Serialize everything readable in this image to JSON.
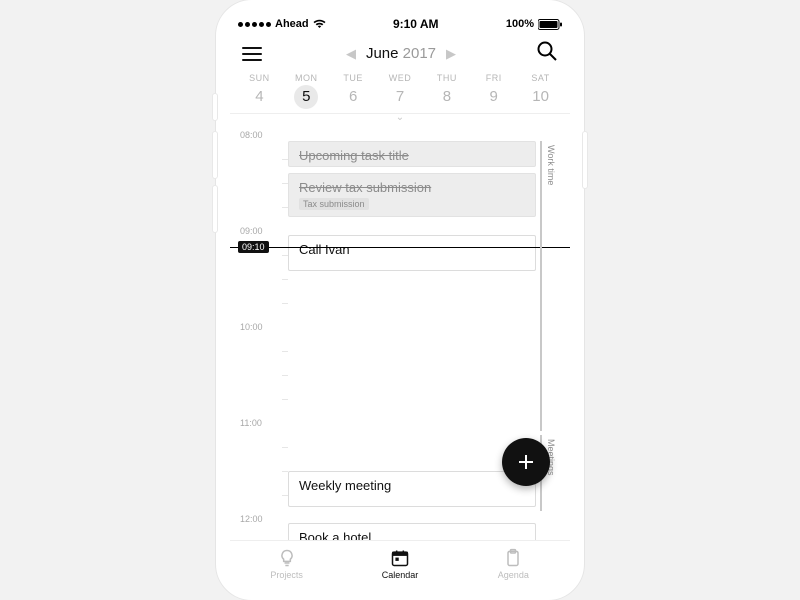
{
  "statusbar": {
    "carrier": "Ahead",
    "time": "9:10 AM",
    "battery": "100%"
  },
  "header": {
    "month": "June",
    "year": "2017"
  },
  "week": [
    {
      "dow": "SUN",
      "day": "4"
    },
    {
      "dow": "MON",
      "day": "5",
      "selected": true
    },
    {
      "dow": "TUE",
      "day": "6"
    },
    {
      "dow": "WED",
      "day": "7"
    },
    {
      "dow": "THU",
      "day": "8"
    },
    {
      "dow": "FRI",
      "day": "9"
    },
    {
      "dow": "SAT",
      "day": "10"
    }
  ],
  "hours": [
    "08:00",
    "09:00",
    "10:00",
    "11:00",
    "12:00"
  ],
  "now": "09:10",
  "events": {
    "upcoming": {
      "title": "Upcoming task title"
    },
    "review": {
      "title": "Review tax submission",
      "tag": "Tax submission"
    },
    "call": {
      "title": "Call Ivan"
    },
    "weekly": {
      "title": "Weekly meeting"
    },
    "hotel": {
      "title": "Book a hotel"
    }
  },
  "sidebars": {
    "work": "Work time",
    "meetings": "Meetings"
  },
  "tabs": {
    "projects": "Projects",
    "calendar": "Calendar",
    "agenda": "Agenda"
  }
}
